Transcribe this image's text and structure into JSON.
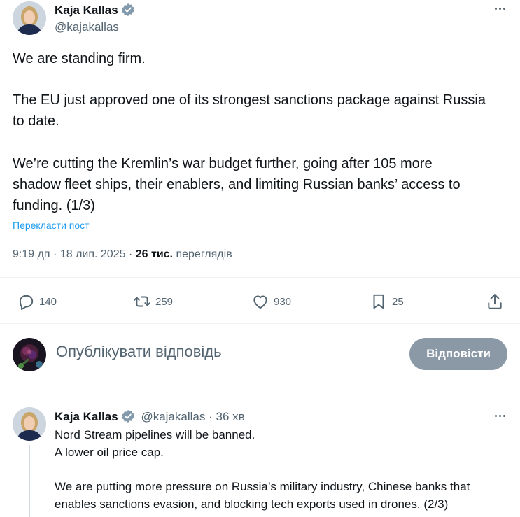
{
  "main_tweet": {
    "author_name": "Kaja Kallas",
    "author_handle": "@kajakallas",
    "lines": [
      "We are standing firm.",
      "The EU just approved one of its strongest sanctions package against Russia",
      "to date.",
      "We’re cutting the Kremlin’s war budget further, going after 105 more",
      "shadow fleet ships, their enablers, and limiting Russian banks’ access to",
      "funding. (1/3)"
    ],
    "translate_label": "Перекласти пост",
    "time": "9:19 дп",
    "date": "18 лип. 2025",
    "separator": "·",
    "views_count": "26 тис.",
    "views_label": "переглядів",
    "actions": {
      "replies": "140",
      "reposts": "259",
      "likes": "930",
      "bookmarks": "25"
    }
  },
  "reply_box": {
    "placeholder": "Опублікувати відповідь",
    "button_label": "Відповісти"
  },
  "thread_reply": {
    "author_name": "Kaja Kallas",
    "author_handle": "@kajakallas",
    "time_sep": "·",
    "time_ago": "36 хв",
    "lines": [
      "Nord Stream pipelines will be banned.",
      "A lower oil price cap.",
      "We are putting more pressure on Russia’s military industry, Chinese banks that",
      "enables sanctions evasion, and blocking tech exports used in drones. (2/3)"
    ]
  },
  "colors": {
    "text_primary": "#0f1419",
    "text_secondary": "#536471",
    "link": "#1d9bf0",
    "verified_badge": "#829aab",
    "reply_button_disabled": "#8b98a5",
    "divider": "#eff3f4"
  },
  "icons": [
    "verified-badge-icon",
    "more-icon",
    "reply-icon",
    "repost-icon",
    "like-icon",
    "bookmark-icon",
    "share-icon"
  ]
}
